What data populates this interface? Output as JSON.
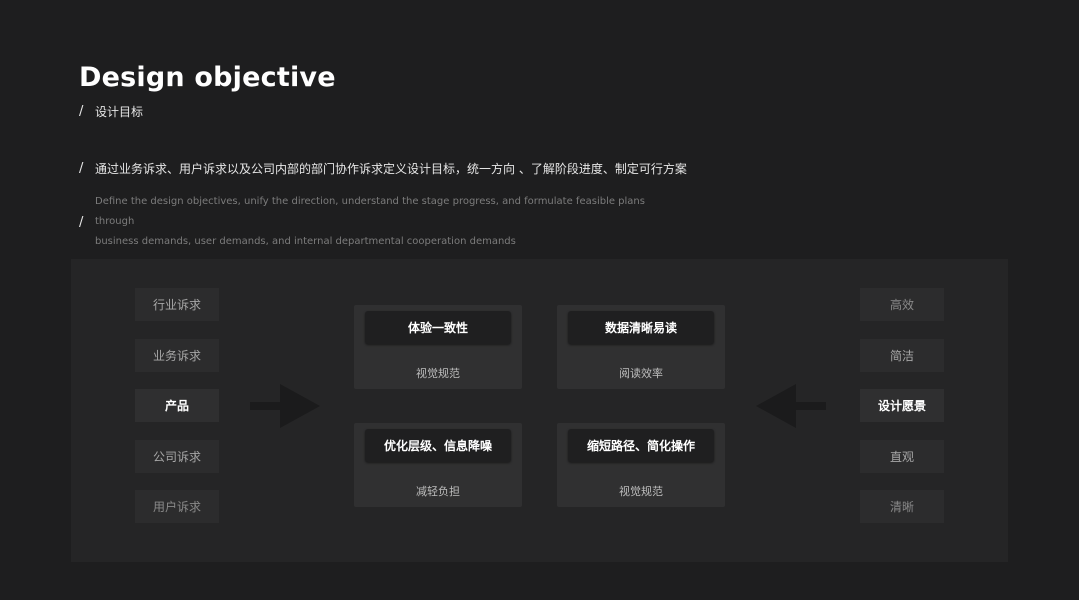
{
  "header": {
    "title": "Design objective",
    "subtitle_slash": "/",
    "subtitle": "设计目标"
  },
  "description": {
    "slash": "/",
    "cn": "通过业务诉求、用户诉求以及公司内部的部门协作诉求定义设计目标，统一方向 、了解阶段进度、制定可行方案",
    "en_slash": "/",
    "en_line1": "Define the design objectives, unify the direction, understand the stage progress, and formulate feasible plans through",
    "en_line2": "business demands, user demands, and internal departmental cooperation demands"
  },
  "left_column": {
    "items": [
      "行业诉求",
      "业务诉求",
      "产品",
      "公司诉求",
      "用户诉求"
    ]
  },
  "right_column": {
    "items": [
      "高效",
      "简洁",
      "设计愿景",
      "直观",
      "清晰"
    ]
  },
  "cards": [
    {
      "title": "体验一致性",
      "sub": "视觉规范"
    },
    {
      "title": "数据清晰易读",
      "sub": "阅读效率"
    },
    {
      "title": "优化层级、信息降噪",
      "sub": "减轻负担"
    },
    {
      "title": "缩短路径、简化操作",
      "sub": "视觉规范"
    }
  ],
  "icons": {
    "left_arrow": "arrow-right-icon",
    "right_arrow": "arrow-left-icon"
  },
  "colors": {
    "background": "#1e1e1f",
    "panel": "#252526",
    "card": "#303031",
    "card_head": "#1f1f20"
  }
}
